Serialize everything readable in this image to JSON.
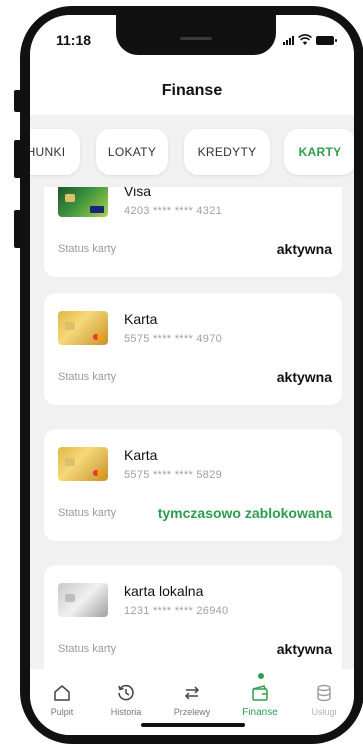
{
  "status_bar": {
    "time": "11:18"
  },
  "header": {
    "title": "Finanse"
  },
  "tabs": [
    {
      "label": "HUNKI",
      "active": false
    },
    {
      "label": "LOKATY",
      "active": false
    },
    {
      "label": "KREDYTY",
      "active": false
    },
    {
      "label": "KARTY",
      "active": true
    }
  ],
  "cards": [
    {
      "name": "Visa",
      "number": "4203 **** **** 4321",
      "status_label": "Status karty",
      "status": "aktywna",
      "thumb": "green-visa-card"
    },
    {
      "name": "Karta",
      "number": "5575 **** **** 4970",
      "status_label": "Status karty",
      "status": "aktywna",
      "thumb": "gold-mastercard"
    },
    {
      "name": "Karta",
      "number": "5575 **** **** 5829",
      "status_label": "Status karty",
      "status": "tymczasowo zablokowana",
      "thumb": "gold-mastercard"
    },
    {
      "name": "karta lokalna",
      "number": "1231 **** **** 26940",
      "status_label": "Status karty",
      "status": "aktywna",
      "thumb": "silver-card"
    }
  ],
  "bottom_nav": [
    {
      "label": "Pulpit",
      "icon": "home-icon",
      "active": false
    },
    {
      "label": "Historia",
      "icon": "history-icon",
      "active": false
    },
    {
      "label": "Przelewy",
      "icon": "transfer-icon",
      "active": false
    },
    {
      "label": "Finanse",
      "icon": "wallet-icon",
      "active": true
    },
    {
      "label": "Usługi",
      "icon": "database-icon",
      "active": false
    }
  ],
  "colors": {
    "accent": "#2d9d4f",
    "background": "#f1f1f1",
    "card": "#ffffff"
  }
}
